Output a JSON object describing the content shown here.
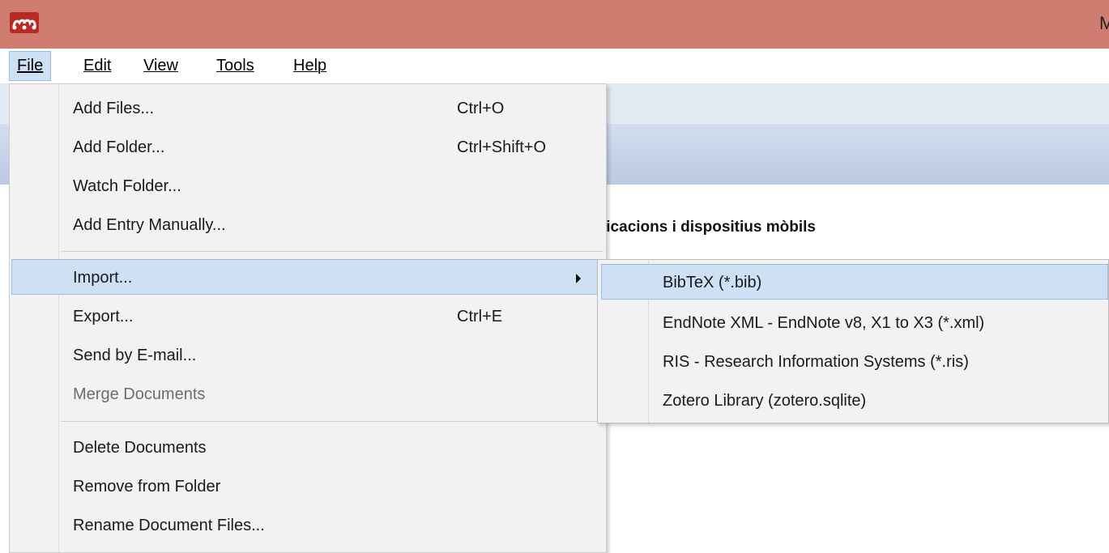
{
  "titlebar": {
    "title": "M",
    "logo_icon": "mendeley-logo-icon",
    "bg_color": "#cf7d70"
  },
  "menubar": {
    "items": [
      {
        "label": "File",
        "mnemonic_index": 0,
        "active": true
      },
      {
        "label": "Edit",
        "mnemonic_index": 0,
        "active": false
      },
      {
        "label": "View",
        "mnemonic_index": 0,
        "active": false
      },
      {
        "label": "Tools",
        "mnemonic_index": 0,
        "active": false
      },
      {
        "label": "Help",
        "mnemonic_index": 0,
        "active": false
      }
    ]
  },
  "background": {
    "heading_partial": "licacions i dispositius mòbils"
  },
  "file_menu": {
    "items": [
      {
        "label": "Add Files...",
        "shortcut": "Ctrl+O"
      },
      {
        "label": "Add Folder...",
        "shortcut": "Ctrl+Shift+O"
      },
      {
        "label": "Watch Folder...",
        "shortcut": ""
      },
      {
        "label": "Add Entry Manually...",
        "shortcut": ""
      },
      {
        "label": "Import...",
        "shortcut": "",
        "has_submenu": true,
        "highlighted": true
      },
      {
        "label": "Export...",
        "shortcut": "Ctrl+E"
      },
      {
        "label": "Send by E-mail...",
        "shortcut": ""
      },
      {
        "label": "Merge Documents",
        "shortcut": "",
        "disabled": true
      },
      {
        "label": "Delete Documents",
        "shortcut": ""
      },
      {
        "label": "Remove from Folder",
        "shortcut": ""
      },
      {
        "label": "Rename Document Files...",
        "shortcut": ""
      }
    ]
  },
  "import_submenu": {
    "items": [
      {
        "label": "BibTeX (*.bib)",
        "highlighted": true
      },
      {
        "label": "EndNote XML - EndNote v8, X1 to X3 (*.xml)"
      },
      {
        "label": "RIS - Research Information Systems (*.ris)"
      },
      {
        "label": "Zotero Library (zotero.sqlite)"
      }
    ]
  },
  "colors": {
    "highlight_bg": "#cde0f4",
    "highlight_border": "#99bde6",
    "menu_bg": "#f2f2f2",
    "disabled_text": "#6d6d6d"
  }
}
